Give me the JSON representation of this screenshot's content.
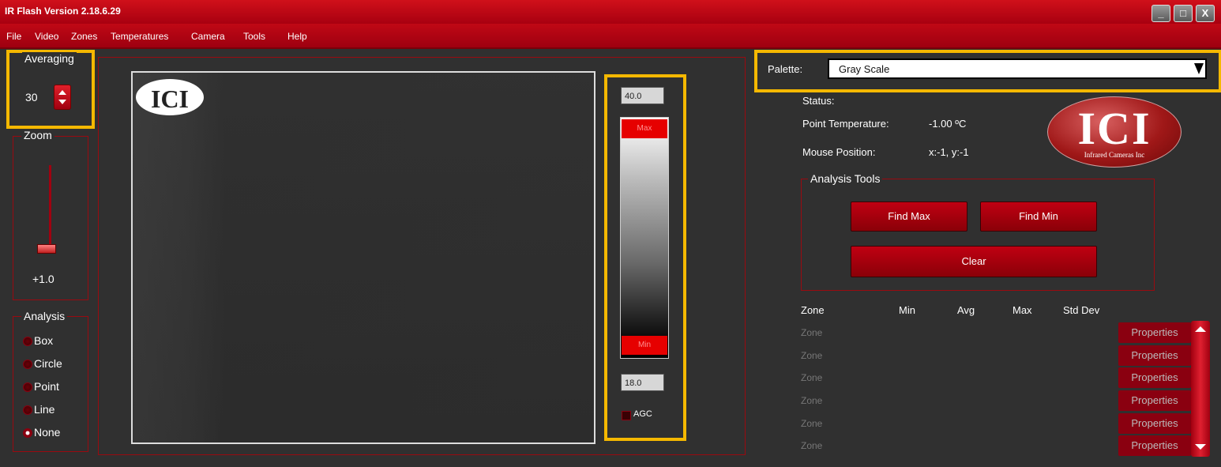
{
  "window": {
    "title": "IR Flash Version 2.18.6.29",
    "controls": [
      "_",
      "□",
      "X"
    ]
  },
  "menu": [
    "File",
    "Video",
    "Zones",
    "Temperatures",
    "Camera",
    "Tools",
    "Help"
  ],
  "averaging": {
    "label": "Averaging",
    "value": "30"
  },
  "zoom": {
    "label": "Zoom",
    "value": "+1.0"
  },
  "analysis": {
    "label": "Analysis",
    "options": [
      "Box",
      "Circle",
      "Point",
      "Line",
      "None"
    ],
    "selected": "None"
  },
  "camera_view": {
    "logo": "ICI"
  },
  "scale": {
    "max_temp": "40.0",
    "min_temp": "18.0",
    "max_label": "Max",
    "min_label": "Min",
    "agc_label": "AGC",
    "agc_checked": false
  },
  "palette": {
    "label": "Palette:",
    "value": "Gray Scale"
  },
  "status": {
    "status_label": "Status:",
    "point_temp_label": "Point Temperature:",
    "point_temp_value": "-1.00 ºC",
    "mouse_label": "Mouse Position:",
    "mouse_value": "x:-1, y:-1"
  },
  "brand": {
    "logo_text": "ICI",
    "tagline": "Infrared Cameras Inc"
  },
  "analysis_tools": {
    "label": "Analysis Tools",
    "find_max": "Find Max",
    "find_min": "Find Min",
    "clear": "Clear"
  },
  "zones": {
    "headers": [
      "Zone",
      "Min",
      "Avg",
      "Max",
      "Std Dev"
    ],
    "rows": [
      "Zone",
      "Zone",
      "Zone",
      "Zone",
      "Zone",
      "Zone"
    ],
    "properties_label": "Properties"
  },
  "colors": {
    "accent": "#c00815",
    "highlight": "#f5b800",
    "background": "#303030"
  }
}
